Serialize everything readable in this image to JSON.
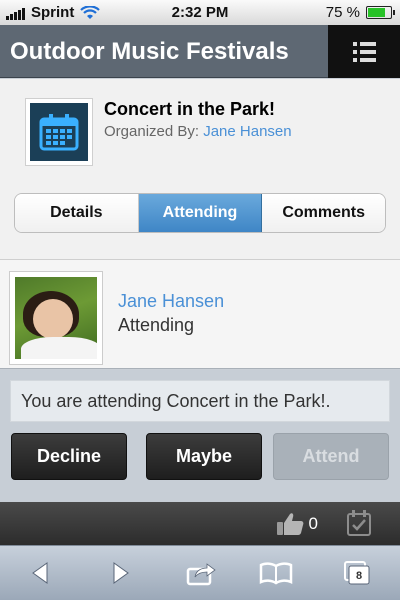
{
  "status_bar": {
    "carrier": "Sprint",
    "time": "2:32 PM",
    "battery": "75 %",
    "battery_level": 0.75
  },
  "header": {
    "title": "Outdoor Music Festivals",
    "menu_icon": "list-icon"
  },
  "event": {
    "title": "Concert in the Park!",
    "organized_by_label": "Organized By:",
    "organizer": "Jane Hansen",
    "icon": "calendar-icon"
  },
  "tabs": [
    {
      "label": "Details",
      "active": false
    },
    {
      "label": "Attending",
      "active": true
    },
    {
      "label": "Comments",
      "active": false
    }
  ],
  "attendee": {
    "name": "Jane Hansen",
    "status": "Attending"
  },
  "response": {
    "message": "You are attending Concert in the Park!.",
    "buttons": [
      {
        "label": "Decline",
        "enabled": true
      },
      {
        "label": "Maybe",
        "enabled": true
      },
      {
        "label": "Attend",
        "enabled": false
      }
    ]
  },
  "app_toolbar": {
    "like_count": "0"
  },
  "safari_toolbar": {
    "tab_count": "8"
  },
  "colors": {
    "accent": "#4a90d6",
    "header": "#5e6873",
    "active_tab": "#4a8fcc"
  }
}
